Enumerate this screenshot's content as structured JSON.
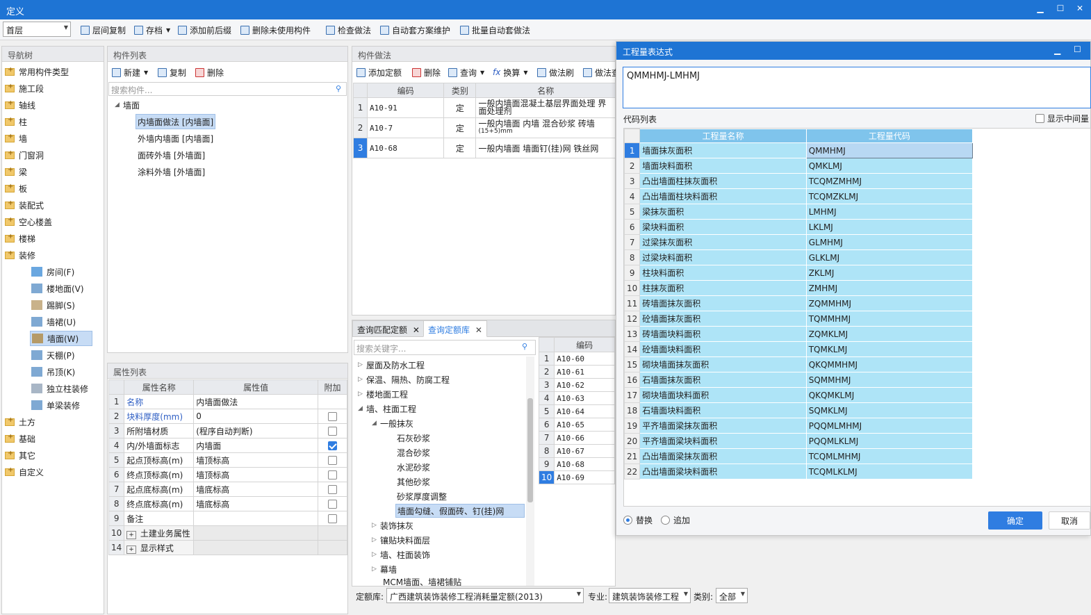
{
  "window": {
    "title": "定义"
  },
  "toolbar": {
    "floor": "首层",
    "buttons": [
      "层间复制",
      "存档",
      "添加前后缀",
      "删除未使用构件",
      "检查做法",
      "自动套方案维护",
      "批量自动套做法"
    ]
  },
  "nav": {
    "title": "导航树",
    "items": [
      "常用构件类型",
      "施工段",
      "轴线",
      "柱",
      "墙",
      "门窗洞",
      "梁",
      "板",
      "装配式",
      "空心楼盖",
      "楼梯",
      "装修"
    ],
    "sub": [
      "房间(F)",
      "楼地面(V)",
      "踢脚(S)",
      "墙裙(U)",
      "墙面(W)",
      "天棚(P)",
      "吊顶(K)",
      "独立柱装修",
      "单梁装修"
    ],
    "items2": [
      "土方",
      "基础",
      "其它",
      "自定义"
    ]
  },
  "complist": {
    "title": "构件列表",
    "new": "新建",
    "copy": "复制",
    "delete": "删除",
    "search_ph": "搜索构件...",
    "root": "墙面",
    "items": [
      "内墙面做法 [内墙面]",
      "外墙内墙面 [内墙面]",
      "面砖外墙 [外墙面]",
      "涂料外墙 [外墙面]"
    ]
  },
  "props": {
    "title": "属性列表",
    "headers": [
      "属性名称",
      "属性值",
      "附加"
    ],
    "rows": [
      {
        "n": "1",
        "name": "名称",
        "val": "内墙面做法"
      },
      {
        "n": "2",
        "name": "块料厚度(mm)",
        "val": "0"
      },
      {
        "n": "3",
        "name": "所附墙材质",
        "val": "(程序自动判断)"
      },
      {
        "n": "4",
        "name": "内/外墙面标志",
        "val": "内墙面"
      },
      {
        "n": "5",
        "name": "起点顶标高(m)",
        "val": "墙顶标高"
      },
      {
        "n": "6",
        "name": "终点顶标高(m)",
        "val": "墙顶标高"
      },
      {
        "n": "7",
        "name": "起点底标高(m)",
        "val": "墙底标高"
      },
      {
        "n": "8",
        "name": "终点底标高(m)",
        "val": "墙底标高"
      },
      {
        "n": "9",
        "name": "备注",
        "val": ""
      },
      {
        "n": "10",
        "name": "土建业务属性",
        "val": ""
      },
      {
        "n": "14",
        "name": "显示样式",
        "val": ""
      }
    ]
  },
  "method": {
    "title": "构件做法",
    "tools": [
      "添加定额",
      "删除",
      "查询",
      "换算",
      "做法刷",
      "做法查"
    ],
    "headers": [
      "编码",
      "类别",
      "名称"
    ],
    "rows": [
      {
        "n": "1",
        "code": "A10-91",
        "type": "定",
        "name1": "一般内墙面混凝土基层界面处理 界",
        "name2": "面处理剂"
      },
      {
        "n": "2",
        "code": "A10-7",
        "type": "定",
        "name1": "一般内墙面 内墙 混合砂浆 砖墙",
        "name2": "(15+5)mm"
      },
      {
        "n": "3",
        "code": "A10-68",
        "type": "定",
        "name1": "一般内墙面 墙面钉(挂)网 铁丝网",
        "name2": ""
      }
    ]
  },
  "query": {
    "tab1": "查询匹配定额",
    "tab2": "查询定额库",
    "search_ph": "搜索关键字...",
    "tree": [
      "屋面及防水工程",
      "保温、隔热、防腐工程",
      "楼地面工程",
      "墙、柱面工程",
      "一般抹灰",
      "石灰砂浆",
      "混合砂浆",
      "水泥砂浆",
      "其他砂浆",
      "砂浆厚度调整",
      "墙面勾缝、假面砖、钉(挂)网",
      "装饰抹灰",
      "镶贴块料面层",
      "墙、柱面装饰",
      "幕墙",
      "MCM墙面、墙裙铺贴"
    ],
    "code_header": "编码",
    "codes": [
      "A10-60",
      "A10-61",
      "A10-62",
      "A10-63",
      "A10-64",
      "A10-65",
      "A10-66",
      "A10-67",
      "A10-68",
      "A10-69"
    ]
  },
  "bottom": {
    "lib_label": "定额库:",
    "lib": "广西建筑装饰装修工程消耗量定额(2013)",
    "spec_label": "专业:",
    "spec": "建筑装饰装修工程",
    "cat_label": "类别:",
    "cat": "全部"
  },
  "dialog": {
    "title": "工程量表达式",
    "expr": "QMMHMJ-LMHMJ",
    "codelist": "代码列表",
    "show_mid": "显示中间量",
    "headers": [
      "工程量名称",
      "工程量代码"
    ],
    "rows": [
      [
        "墙面抹灰面积",
        "QMMHMJ"
      ],
      [
        "墙面块料面积",
        "QMKLMJ"
      ],
      [
        "凸出墙面柱抹灰面积",
        "TCQMZMHMJ"
      ],
      [
        "凸出墙面柱块料面积",
        "TCQMZKLMJ"
      ],
      [
        "梁抹灰面积",
        "LMHMJ"
      ],
      [
        "梁块料面积",
        "LKLMJ"
      ],
      [
        "过梁抹灰面积",
        "GLMHMJ"
      ],
      [
        "过梁块料面积",
        "GLKLMJ"
      ],
      [
        "柱块料面积",
        "ZKLMJ"
      ],
      [
        "柱抹灰面积",
        "ZMHMJ"
      ],
      [
        "砖墙面抹灰面积",
        "ZQMMHMJ"
      ],
      [
        "砼墙面抹灰面积",
        "TQMMHMJ"
      ],
      [
        "砖墙面块料面积",
        "ZQMKLMJ"
      ],
      [
        "砼墙面块料面积",
        "TQMKLMJ"
      ],
      [
        "砌块墙面抹灰面积",
        "QKQMMHMJ"
      ],
      [
        "石墙面抹灰面积",
        "SQMMHMJ"
      ],
      [
        "砌块墙面块料面积",
        "QKQMKLMJ"
      ],
      [
        "石墙面块料面积",
        "SQMKLMJ"
      ],
      [
        "平齐墙面梁抹灰面积",
        "PQQMLMHMJ"
      ],
      [
        "平齐墙面梁块料面积",
        "PQQMLKLMJ"
      ],
      [
        "凸出墙面梁抹灰面积",
        "TCQMLMHMJ"
      ],
      [
        "凸出墙面梁块料面积",
        "TCQMLKLMJ"
      ]
    ],
    "replace": "替换",
    "append": "追加",
    "ok": "确定",
    "cancel": "取消"
  }
}
